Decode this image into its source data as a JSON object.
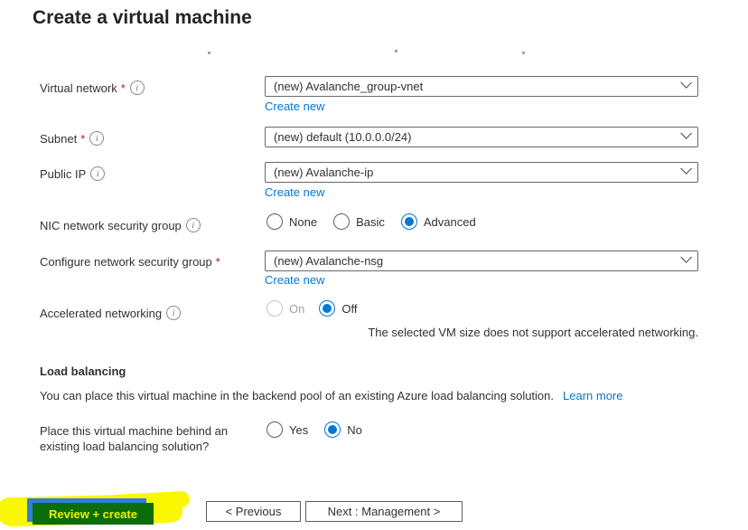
{
  "title": "Create a virtual machine",
  "required_marker": "*",
  "icons": {
    "info_glyph": "i"
  },
  "fields": {
    "virtual_network": {
      "label": "Virtual network",
      "value": "(new) Avalanche_group-vnet",
      "create_new": "Create new"
    },
    "subnet": {
      "label": "Subnet",
      "value": "(new) default (10.0.0.0/24)"
    },
    "public_ip": {
      "label": "Public IP",
      "value": "(new) Avalanche-ip",
      "create_new": "Create new"
    },
    "nic_nsg": {
      "label": "NIC network security group",
      "options": {
        "none": "None",
        "basic": "Basic",
        "advanced": "Advanced"
      },
      "selected": "Advanced"
    },
    "configure_nsg": {
      "label": "Configure network security group",
      "value": "(new) Avalanche-nsg",
      "create_new": "Create new"
    },
    "accelerated_networking": {
      "label": "Accelerated networking",
      "options": {
        "on": "On",
        "off": "Off"
      },
      "selected": "Off",
      "disabled_option": "On",
      "note": "The selected VM size does not support accelerated networking."
    }
  },
  "load_balancing": {
    "heading": "Load balancing",
    "description": "You can place this virtual machine in the backend pool of an existing Azure load balancing solution.",
    "learn_more": "Learn more",
    "question": "Place this virtual machine behind an existing load balancing solution?",
    "options": {
      "yes": "Yes",
      "no": "No"
    },
    "selected": "No"
  },
  "footer": {
    "review_create": "Review + create",
    "previous": "< Previous",
    "next": "Next : Management >"
  },
  "colors": {
    "accent": "#0078d4",
    "required": "#a4262c",
    "link": "#0078d4",
    "highlighter": "#f9f800",
    "review_button_bg": "#0a6d0a",
    "review_button_text": "#eef000"
  }
}
